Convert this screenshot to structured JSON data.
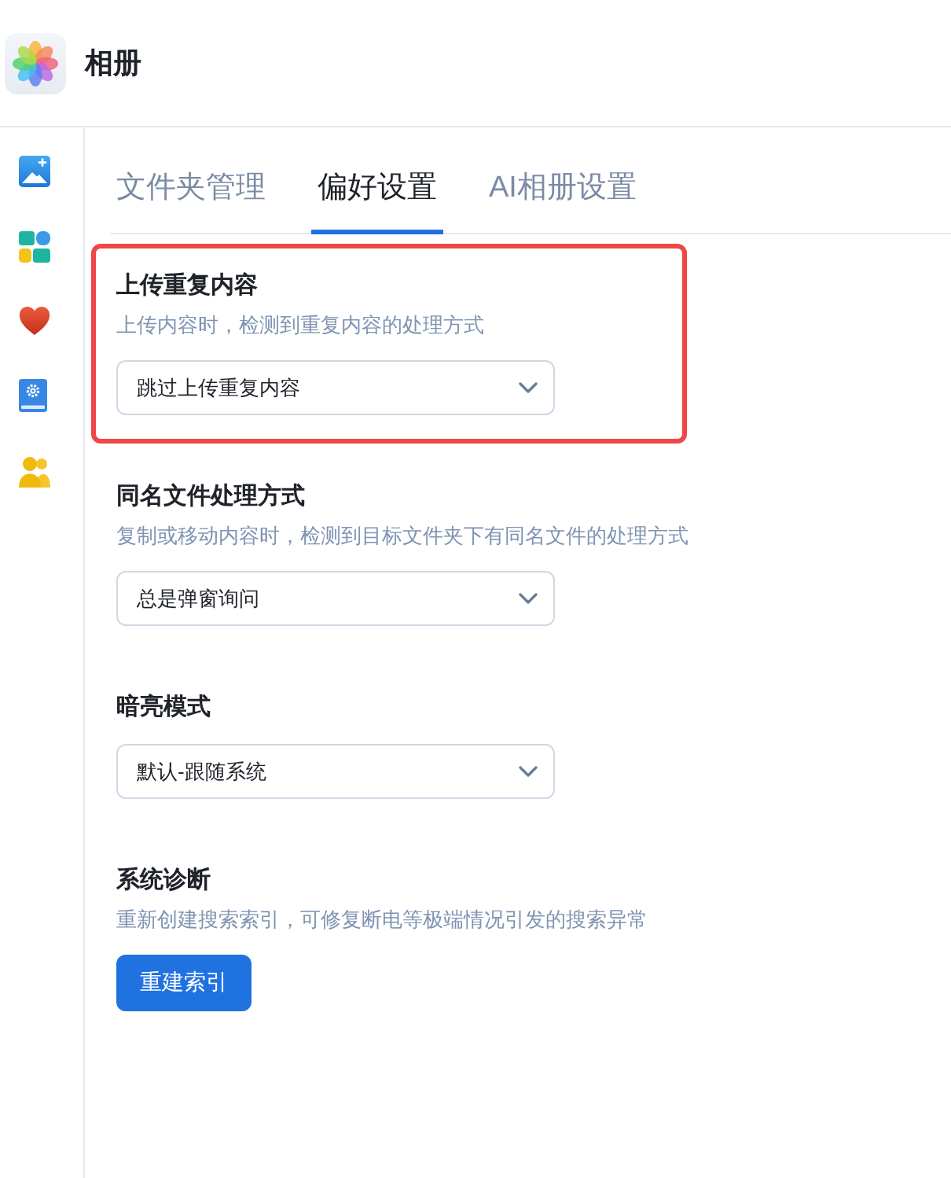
{
  "app": {
    "title": "相册"
  },
  "sidebar": {
    "items": [
      {
        "kind": "image"
      },
      {
        "kind": "tiles"
      },
      {
        "kind": "heart"
      },
      {
        "kind": "book"
      },
      {
        "kind": "people"
      }
    ]
  },
  "tabs": [
    {
      "label": "文件夹管理",
      "selected": false
    },
    {
      "label": "偏好设置",
      "selected": true
    },
    {
      "label": "AI相册设置",
      "selected": false
    }
  ],
  "sections": [
    {
      "kind": "select",
      "title": "上传重复内容",
      "description": "上传内容时，检测到重复内容的处理方式",
      "value": "跳过上传重复内容",
      "highlighted": true
    },
    {
      "kind": "select",
      "title": "同名文件处理方式",
      "description": "复制或移动内容时，检测到目标文件夹下有同名文件的处理方式",
      "value": "总是弹窗询问",
      "highlighted": false
    },
    {
      "kind": "select",
      "title": "暗亮模式",
      "value": "默认-跟随系统",
      "highlighted": false
    },
    {
      "kind": "button",
      "title": "系统诊断",
      "description": "重新创建搜索索引，可修复断电等极端情况引发的搜索异常",
      "button": "重建索引",
      "highlighted": false
    }
  ]
}
